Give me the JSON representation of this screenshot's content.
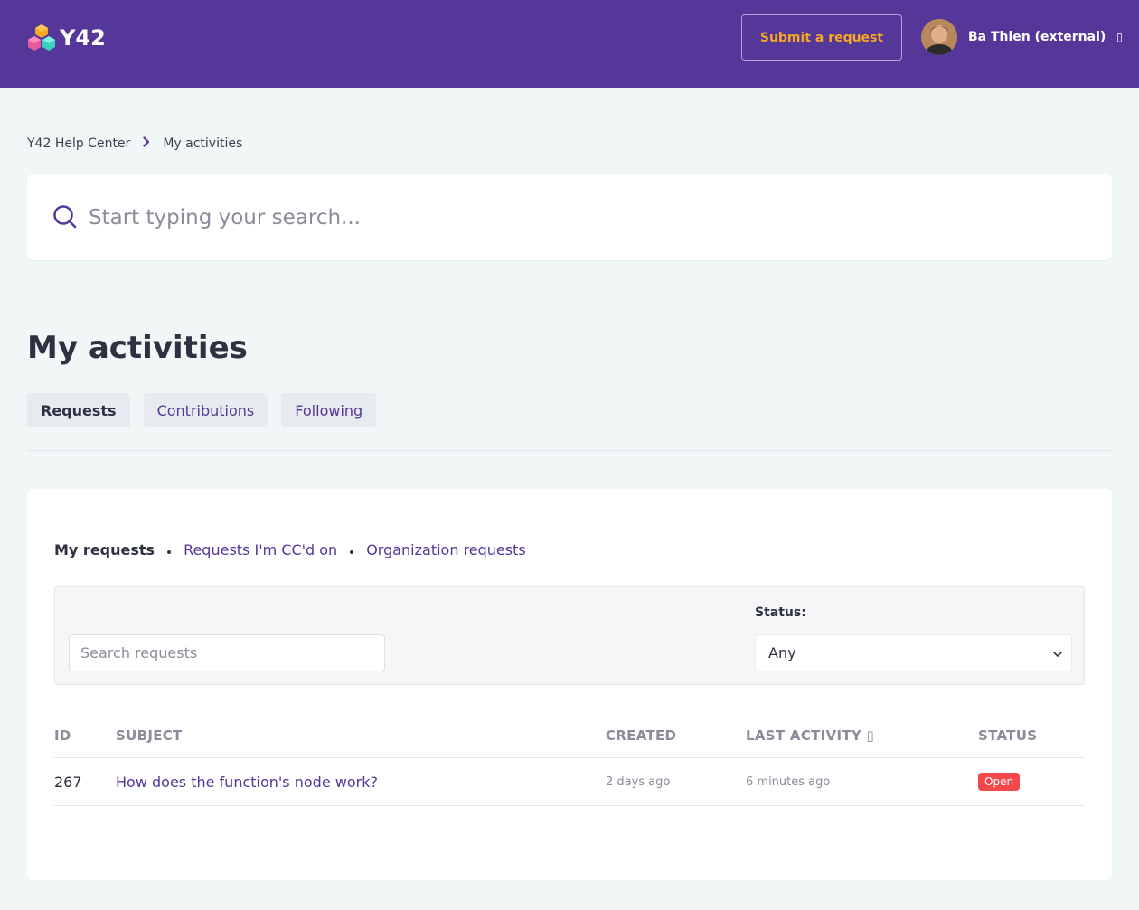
{
  "header": {
    "logo_text": "Y42",
    "submit_label": "Submit a request",
    "user_name": "Ba Thien (external)",
    "user_caret": "▯",
    "colors": {
      "bg": "#553799",
      "accent": "#f5a623"
    }
  },
  "breadcrumb": {
    "items": [
      "Y42 Help Center",
      "My activities"
    ],
    "separator_icon": "chevron-right-icon"
  },
  "search": {
    "placeholder": "Start typing your search..."
  },
  "page_title": "My activities",
  "tabs": [
    {
      "label": "Requests",
      "active": true
    },
    {
      "label": "Contributions",
      "active": false
    },
    {
      "label": "Following",
      "active": false
    }
  ],
  "subnav": {
    "items": [
      "My requests",
      "Requests I'm CC'd on",
      "Organization requests"
    ]
  },
  "filters": {
    "search_placeholder": "Search requests",
    "status_label": "Status:",
    "status_value": "Any"
  },
  "table": {
    "headers": [
      "ID",
      "SUBJECT",
      "CREATED",
      "LAST ACTIVITY ▯",
      "STATUS"
    ],
    "rows": [
      {
        "id": "267",
        "subject": "How does the function's node work?",
        "created": "2 days ago",
        "last_activity": "6 minutes ago",
        "status": "Open"
      }
    ]
  },
  "colors": {
    "status_open": "#f3474b",
    "link": "#553799"
  }
}
